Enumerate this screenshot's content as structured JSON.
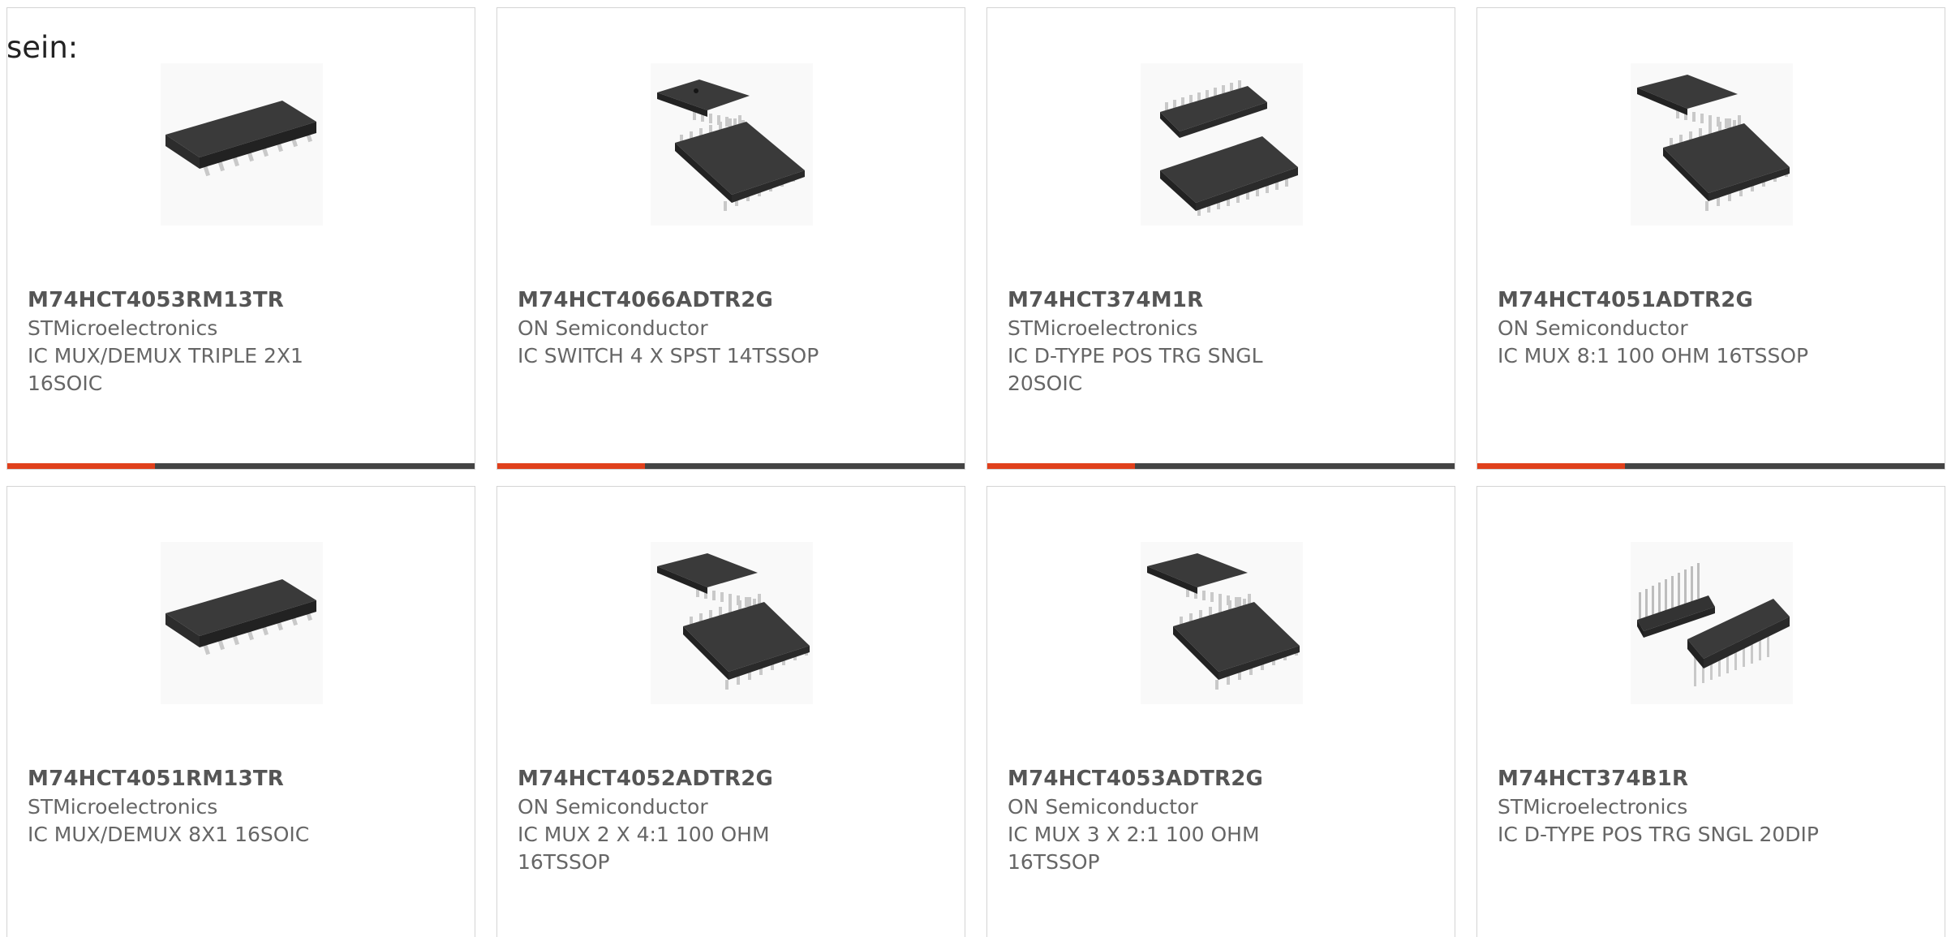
{
  "intro_text": "sein:",
  "colors": {
    "accent": "#e0401c",
    "bar": "#444444",
    "border": "#d4d4d4",
    "text": "#666666",
    "title": "#555555"
  },
  "products": [
    {
      "part_number": "M74HCT4053RM13TR",
      "manufacturer": "STMicroelectronics",
      "description": "IC MUX/DEMUX TRIPLE 2X1 16SOIC",
      "image_icon": "soic-16-chip-icon"
    },
    {
      "part_number": "M74HCT4066ADTR2G",
      "manufacturer": "ON Semiconductor",
      "description": "IC SWITCH 4 X SPST 14TSSOP",
      "image_icon": "tssop-14-chip-pair-icon"
    },
    {
      "part_number": "M74HCT374M1R",
      "manufacturer": "STMicroelectronics",
      "description": "IC D-TYPE POS TRG SNGL 20SOIC",
      "image_icon": "soic-20-chip-pair-icon"
    },
    {
      "part_number": "M74HCT4051ADTR2G",
      "manufacturer": "ON Semiconductor",
      "description": "IC MUX 8:1 100 OHM 16TSSOP",
      "image_icon": "tssop-16-chip-pair-icon"
    },
    {
      "part_number": "M74HCT4051RM13TR",
      "manufacturer": "STMicroelectronics",
      "description": "IC MUX/DEMUX 8X1 16SOIC",
      "image_icon": "soic-16-chip-icon"
    },
    {
      "part_number": "M74HCT4052ADTR2G",
      "manufacturer": "ON Semiconductor",
      "description": "IC MUX 2 X 4:1 100 OHM 16TSSOP",
      "image_icon": "tssop-16-chip-pair-icon"
    },
    {
      "part_number": "M74HCT4053ADTR2G",
      "manufacturer": "ON Semiconductor",
      "description": "IC MUX 3 X 2:1 100 OHM 16TSSOP",
      "image_icon": "tssop-16-chip-pair-icon"
    },
    {
      "part_number": "M74HCT374B1R",
      "manufacturer": "STMicroelectronics",
      "description": "IC D-TYPE POS TRG SNGL 20DIP",
      "image_icon": "dip-20-chip-pair-icon"
    }
  ]
}
